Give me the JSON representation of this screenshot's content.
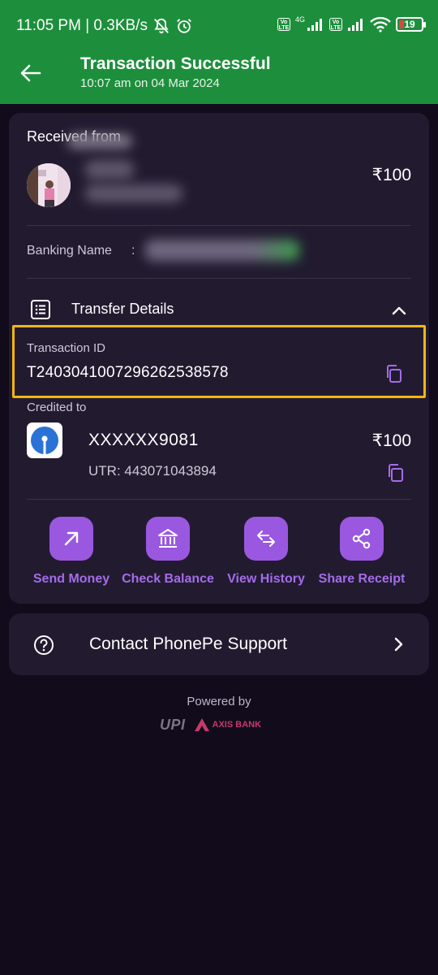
{
  "status_bar": {
    "time_speed": "11:05 PM | 0.3KB/s",
    "volte": "Vo LTE",
    "network": "4G",
    "battery": "19"
  },
  "header": {
    "title": "Transaction Successful",
    "subtitle": "10:07 am on 04 Mar 2024"
  },
  "sender": {
    "label": "Received from",
    "amount": "₹100",
    "banking_name_label": "Banking Name",
    "colon": ":"
  },
  "transfer": {
    "section_label": "Transfer Details",
    "txn_id_label": "Transaction ID",
    "txn_id": "T2403041007296262538578",
    "credited_label": "Credited to",
    "account": "XXXXXX9081",
    "amount": "₹100",
    "utr": "UTR: 443071043894"
  },
  "actions": [
    {
      "label": "Send Money",
      "icon": "arrow-up-right-icon"
    },
    {
      "label": "Check Balance",
      "icon": "bank-icon"
    },
    {
      "label": "View History",
      "icon": "swap-arrows-icon"
    },
    {
      "label": "Share Receipt",
      "icon": "share-icon"
    }
  ],
  "support": {
    "label": "Contact PhonePe Support"
  },
  "footer": {
    "powered_by": "Powered by",
    "upi": "UPI",
    "bank": "AXIS BANK"
  },
  "colors": {
    "header_green": "#1d8f3c",
    "accent_purple": "#9a58e0",
    "card_bg": "#221b30",
    "page_bg": "#120b1c",
    "highlight_box": "#f2b60f"
  }
}
